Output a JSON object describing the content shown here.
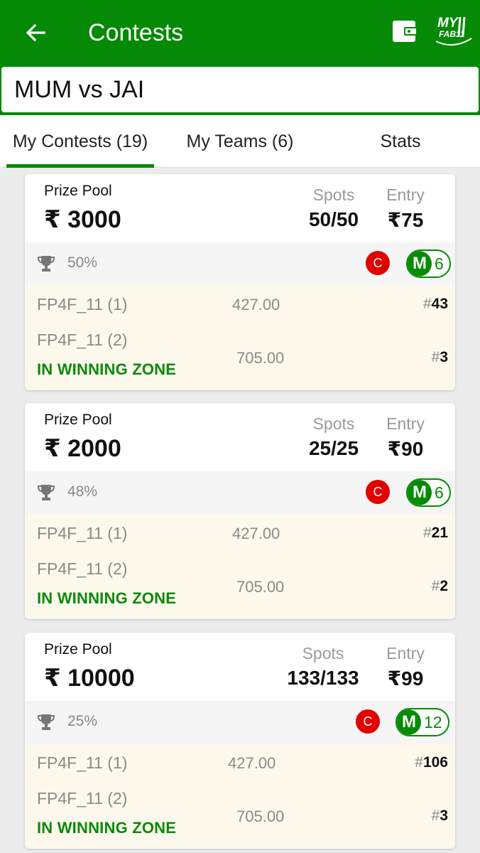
{
  "header": {
    "title": "Contests",
    "logo_text_top": "MY",
    "logo_text_bottom": "FAB11"
  },
  "match": {
    "title": "MUM vs JAI"
  },
  "tabs": [
    {
      "label": "My Contests (19)",
      "active": true
    },
    {
      "label": "My Teams (6)",
      "active": false
    },
    {
      "label": "Stats",
      "active": false
    }
  ],
  "colors": {
    "brand_green": "#058a05",
    "badge_red": "#e00000",
    "team_bg": "#fdf8ec"
  },
  "contests": [
    {
      "prize_label": "Prize Pool",
      "prize": "₹ 3000",
      "spots_label": "Spots",
      "spots": "50/50",
      "entry_label": "Entry",
      "entry": "₹75",
      "win_pct": "50%",
      "c_label": "C",
      "m_label": "M",
      "m_count": "6",
      "teams": [
        {
          "name": "FP4F_11 (1)",
          "points": "427.00",
          "rank_prefix": "#",
          "rank": "43"
        },
        {
          "name": "FP4F_11 (2)",
          "points": "705.00",
          "rank_prefix": "#",
          "rank": "3"
        }
      ],
      "status": "IN WINNING ZONE"
    },
    {
      "prize_label": "Prize Pool",
      "prize": "₹ 2000",
      "spots_label": "Spots",
      "spots": "25/25",
      "entry_label": "Entry",
      "entry": "₹90",
      "win_pct": "48%",
      "c_label": "C",
      "m_label": "M",
      "m_count": "6",
      "teams": [
        {
          "name": "FP4F_11 (1)",
          "points": "427.00",
          "rank_prefix": "#",
          "rank": "21"
        },
        {
          "name": "FP4F_11 (2)",
          "points": "705.00",
          "rank_prefix": "#",
          "rank": "2"
        }
      ],
      "status": "IN WINNING ZONE"
    },
    {
      "prize_label": "Prize Pool",
      "prize": "₹ 10000",
      "spots_label": "Spots",
      "spots": "133/133",
      "entry_label": "Entry",
      "entry": "₹99",
      "win_pct": "25%",
      "c_label": "C",
      "m_label": "M",
      "m_count": "12",
      "teams": [
        {
          "name": "FP4F_11 (1)",
          "points": "427.00",
          "rank_prefix": "#",
          "rank": "106"
        },
        {
          "name": "FP4F_11 (2)",
          "points": "705.00",
          "rank_prefix": "#",
          "rank": "3"
        }
      ],
      "status": "IN WINNING ZONE"
    }
  ]
}
